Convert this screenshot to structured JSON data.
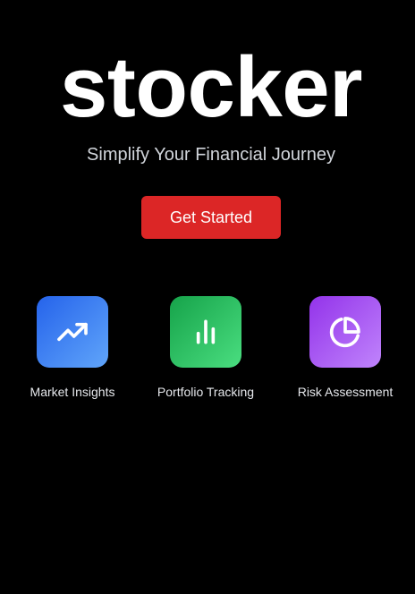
{
  "app": {
    "logo_text": "stocker",
    "tagline": "Simplify Your Financial Journey"
  },
  "cta": {
    "label": "Get Started",
    "color": "#dc2626"
  },
  "features": [
    {
      "label": "Market Insights",
      "icon": "trending-up-icon",
      "color_from": "#2563eb",
      "color_to": "#60a5fa"
    },
    {
      "label": "Portfolio Tracking",
      "icon": "bar-chart-icon",
      "color_from": "#16a34a",
      "color_to": "#4ade80"
    },
    {
      "label": "Risk Assessment",
      "icon": "pie-chart-icon",
      "color_from": "#9333ea",
      "color_to": "#c084fc"
    }
  ]
}
